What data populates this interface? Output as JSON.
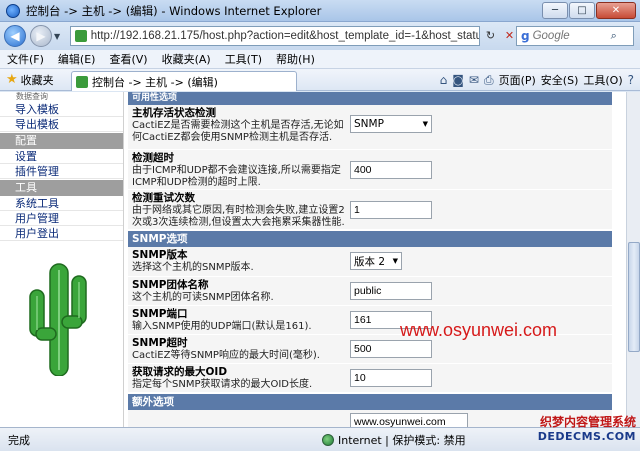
{
  "window": {
    "title": "控制台 -> 主机 -> (编辑) - Windows Internet Explorer",
    "buttons": {
      "minimize": "─",
      "maximize": "□",
      "close": "✕"
    }
  },
  "address": {
    "url": "http://192.168.21.175/host.php?action=edit&host_template_id=-1&host_status",
    "search_placeholder": "Google"
  },
  "menu": [
    "文件(F)",
    "编辑(E)",
    "查看(V)",
    "收藏夹(A)",
    "工具(T)",
    "帮助(H)"
  ],
  "commandbar": {
    "favorites": "收藏夹",
    "tab_title": "控制台 -> 主机 -> (编辑)",
    "page": "页面(P)",
    "safety": "安全(S)",
    "tools": "工具(O)"
  },
  "sidebar": {
    "top_label": "数据查询",
    "items1": [
      "导入模板",
      "导出模板"
    ],
    "config_header": "配置",
    "items2": [
      "设置",
      "插件管理"
    ],
    "tools_header": "工具",
    "items3": [
      "系统工具",
      "用户管理",
      "用户登出"
    ]
  },
  "form": {
    "top_section": "可用性选项",
    "rows1": [
      {
        "title": "主机存活状态检测",
        "desc": "CactiEZ是否需要检测这个主机是否存活,无论如何CactiEZ都会使用SNMP检测主机是否存活.",
        "kind": "select",
        "value": "SNMP"
      },
      {
        "title": "检测超时",
        "desc": "由于ICMP和UDP都不会建议连接,所以需要指定ICMP和UDP检测的超时上限.",
        "kind": "text",
        "value": "400"
      },
      {
        "title": "检测重试次数",
        "desc": "由于网络或其它原因,有时检测会失败,建立设置2次或3次连续检测,但设置太大会拖累采集器性能.",
        "kind": "text",
        "value": "1"
      }
    ],
    "snmp_section": "SNMP选项",
    "rows2": [
      {
        "title": "SNMP版本",
        "desc": "选择这个主机的SNMP版本.",
        "kind": "select",
        "value": "版本 2"
      },
      {
        "title": "SNMP团体名称",
        "desc": "这个主机的可读SNMP团体名称.",
        "kind": "text",
        "value": "public"
      },
      {
        "title": "SNMP端口",
        "desc": "输入SNMP使用的UDP端口(默认是161).",
        "kind": "text",
        "value": "161"
      },
      {
        "title": "SNMP超时",
        "desc": "CactiEZ等待SNMP响应的最大时间(毫秒).",
        "kind": "text",
        "value": "500"
      },
      {
        "title": "获取请求的最大OID",
        "desc": "指定每个SNMP获取请求的最大OID长度.",
        "kind": "text",
        "value": "10"
      }
    ],
    "extra_section": "额外选项",
    "extra_value": "www.osyunwei.com"
  },
  "watermark": "www.osyunwei.com",
  "status": {
    "done": "完成",
    "zone": "Internet | 保护模式: 禁用"
  },
  "corner_watermark": {
    "line1": "织梦内容管理系统",
    "line2": "DEDECMS.COM"
  }
}
